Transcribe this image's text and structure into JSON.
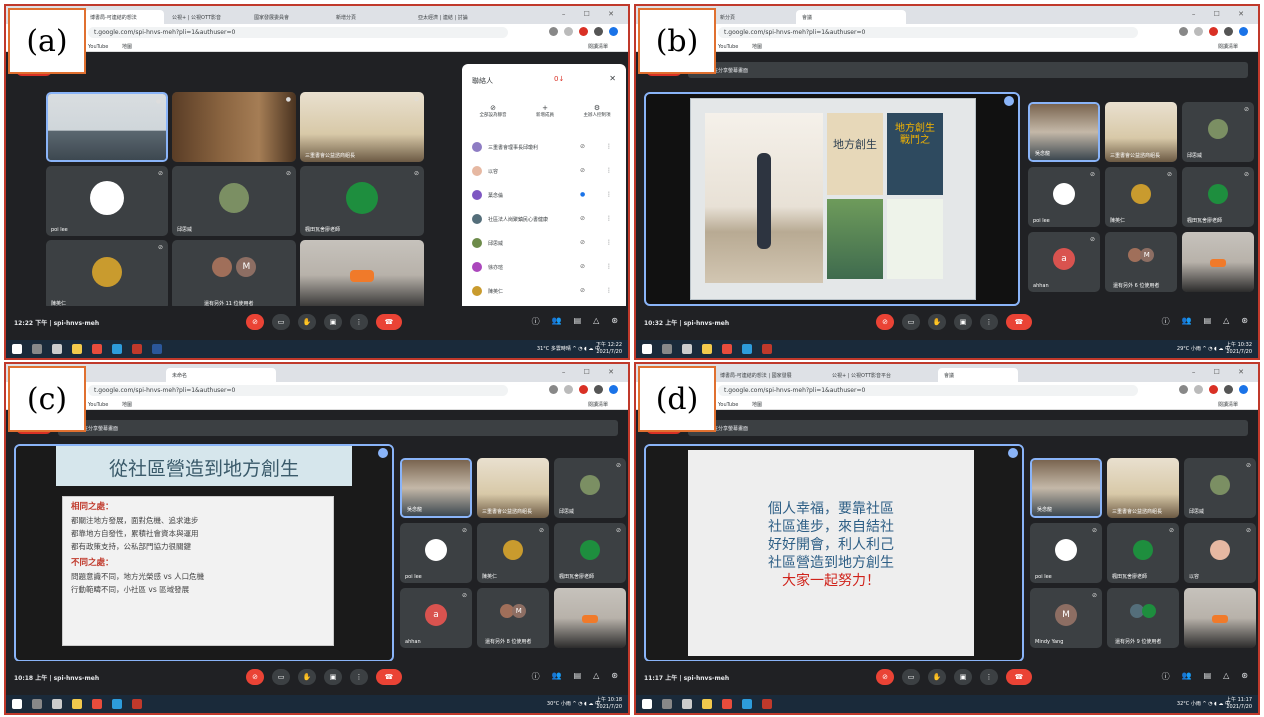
{
  "labels": {
    "a": "(a)",
    "b": "(b)",
    "c": "(c)",
    "d": "(d)"
  },
  "browser": {
    "url": "meet.google.com/spi-hnvs-meh?pli=1&authuser=0",
    "url_short": "t.google.com/spi-hnvs-meh?pli=1&authuser=0",
    "bookmarks": [
      "YouTube",
      "地圖"
    ],
    "reading_list": "閱讀清單",
    "tabs_a": [
      "博書局-可連結的想法",
      "公視+ | 公視OTT影音",
      "國家發展委員會",
      "新增分頁",
      "亞太經濟 | 連結 | 討論"
    ],
    "tabs_b": [
      "新分頁",
      "會議"
    ],
    "tabs_c": [
      "未命名"
    ],
    "tabs_d": [
      "博書局-可連結的想法 | 國家發展",
      "公視+ | 公視OTT影音平台",
      "會議"
    ],
    "window_controls": "– ☐ ✕"
  },
  "meeting": {
    "code": "spi-hnvs-meh",
    "sharing_text": "胥殷正在分享螢幕畫面",
    "presenting_pill": "簡報中",
    "time_a": "12:22 下午",
    "time_b": "10:32 上午",
    "time_c": "10:18 上午",
    "time_d": "11:17 上午"
  },
  "participants": {
    "p1": "吳念龍",
    "p2": "三重書會理事長邱瓊利",
    "p3": "邱思威",
    "p4": "poi lee",
    "p5": "陳英仁",
    "p6": "楓田瓦舍廖老師",
    "p7": "ahhan",
    "p8": "Mindy Yang",
    "p9": "以容",
    "p10": "三重書會公益諮商組長",
    "others_a": "還有另外 11 位使用者",
    "others_b": "還有另外 6 位使用者",
    "others_c": "還有另外 8 位使用者",
    "others_d": "還有另外 9 位使用者",
    "initial_a": "a",
    "initial_m": "M"
  },
  "people_panel": {
    "title": "聯絡人",
    "actions": [
      "全部設為靜音",
      "新增成員",
      "主辦人控制項"
    ],
    "rows": [
      "三重書會理事長邱瓊利",
      "以容",
      "葉念倫",
      "社區法人崗聚鎮民心書健康",
      "邱思威",
      "徐亦瑄",
      "陳英仁"
    ],
    "badge": "0"
  },
  "slide_b": {
    "book1": "地方創生",
    "book2": "地方創生 戰鬥之"
  },
  "slide_c": {
    "title": "從社區營造到地方創生",
    "same_head": "相同之處：",
    "same_items": [
      "都關注地方發展，面對危機、追求進步",
      "都靠地方自發性，累積社會資本與運用",
      "都有政策支持，公私部門協力很關鍵"
    ],
    "diff_head": "不同之處：",
    "diff_items": [
      "問題意識不同，地方光榮感 vs 人口危機",
      "行動範疇不同，小社區 vs 區域發展"
    ]
  },
  "slide_d": {
    "lines": [
      "個人幸福，要靠社區",
      "社區進步，來自結社",
      "好好開會，利人利己",
      "社區營造到地方創生"
    ],
    "red_line": "大家一起努力！"
  },
  "taskbar": {
    "weather_a": "31°C 多雲時晴",
    "weather_b": "29°C 小雨",
    "weather_c": "30°C 小雨",
    "weather_d": "32°C 小雨",
    "clock_a": "下午 12:22",
    "clock_b": "上午 10:32",
    "clock_c": "上午 10:18",
    "clock_d": "上午 11:17",
    "date": "2021/7/20",
    "lang": "中"
  },
  "icons": [
    "mic-off-icon",
    "camera-icon",
    "raise-hand-icon",
    "present-icon",
    "more-icon",
    "end-call-icon",
    "info-icon",
    "people-icon",
    "chat-icon",
    "activities-icon",
    "lock-icon"
  ],
  "colors": {
    "meet_bg": "#202124",
    "tile_bg": "#3c4043",
    "end_call": "#ea4335",
    "active_border": "#8ab4f8",
    "label_border": "#e07030",
    "panel_border": "#c0392b"
  }
}
